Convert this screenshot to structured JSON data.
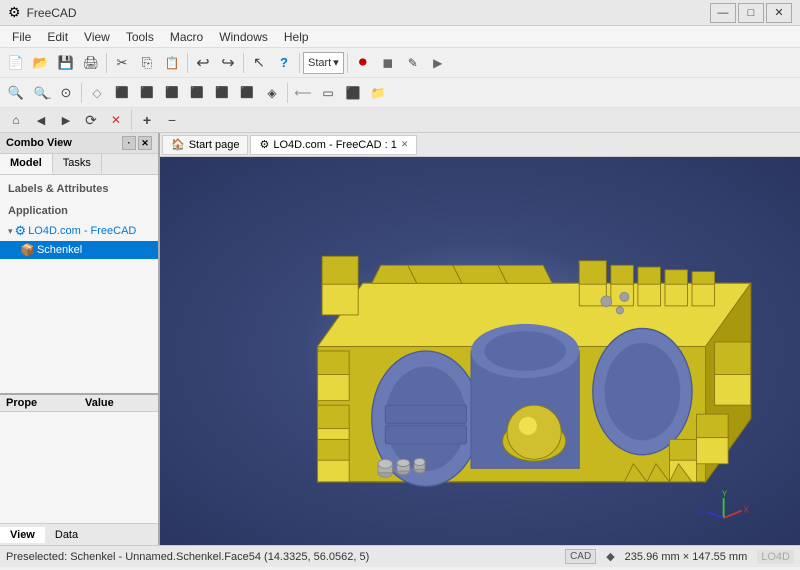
{
  "titlebar": {
    "title": "FreeCAD",
    "icon": "🔧",
    "controls": {
      "minimize": "—",
      "maximize": "□",
      "close": "✕"
    }
  },
  "menubar": {
    "items": [
      "File",
      "Edit",
      "View",
      "Tools",
      "Macro",
      "Windows",
      "Help"
    ]
  },
  "toolbar": {
    "row1": {
      "buttons": [
        "new",
        "open",
        "save",
        "print",
        "separator",
        "cut",
        "copy",
        "paste",
        "separator",
        "undo",
        "redo",
        "separator",
        "pointer",
        "help"
      ],
      "dropdown": "Start",
      "special": [
        "stop-red",
        "stop-grey",
        "macro-draw",
        "macro-play"
      ]
    },
    "row2": {
      "buttons": [
        "zoom-plus",
        "zoom-minus",
        "no-entry",
        "separator",
        "cube",
        "3d-views",
        "home",
        "back",
        "front",
        "right",
        "left",
        "top",
        "bottom",
        "iso",
        "separator",
        "box",
        "folder"
      ]
    },
    "row3": {
      "nav_back": "←",
      "nav_forward": "→",
      "nav_refresh": "⟳",
      "nav_stop": "✕",
      "nav_plus": "+",
      "nav_minus": "−"
    }
  },
  "sidebar": {
    "header": "Combo View",
    "tabs": [
      "Model",
      "Tasks"
    ],
    "active_tab": "Model",
    "section_label": "Labels & Attributes",
    "section2": "Application",
    "tree_items": [
      {
        "id": "freecad",
        "label": "LO4D.com - FreeCAD",
        "icon": "🔧",
        "expanded": true,
        "level": 0
      },
      {
        "id": "schenkel",
        "label": "Schenkel",
        "icon": "📦",
        "selected": true,
        "level": 1
      }
    ],
    "properties": {
      "col1": "Prope",
      "col2": "Value"
    },
    "view_tabs": [
      "View",
      "Data"
    ],
    "active_view_tab": "View"
  },
  "viewport": {
    "tabs": [
      {
        "label": "Start page",
        "icon": "🏠",
        "active": false
      },
      {
        "label": "LO4D.com - FreeCAD : 1",
        "icon": "🔧",
        "active": true
      }
    ]
  },
  "statusbar": {
    "left": "Preselected: Schenkel - Unnamed.Schenkel.Face54 (14.3325, 56.0562, 5)",
    "badges": [
      "CAD"
    ],
    "dimensions": "235.96 mm × 147.55 mm"
  }
}
